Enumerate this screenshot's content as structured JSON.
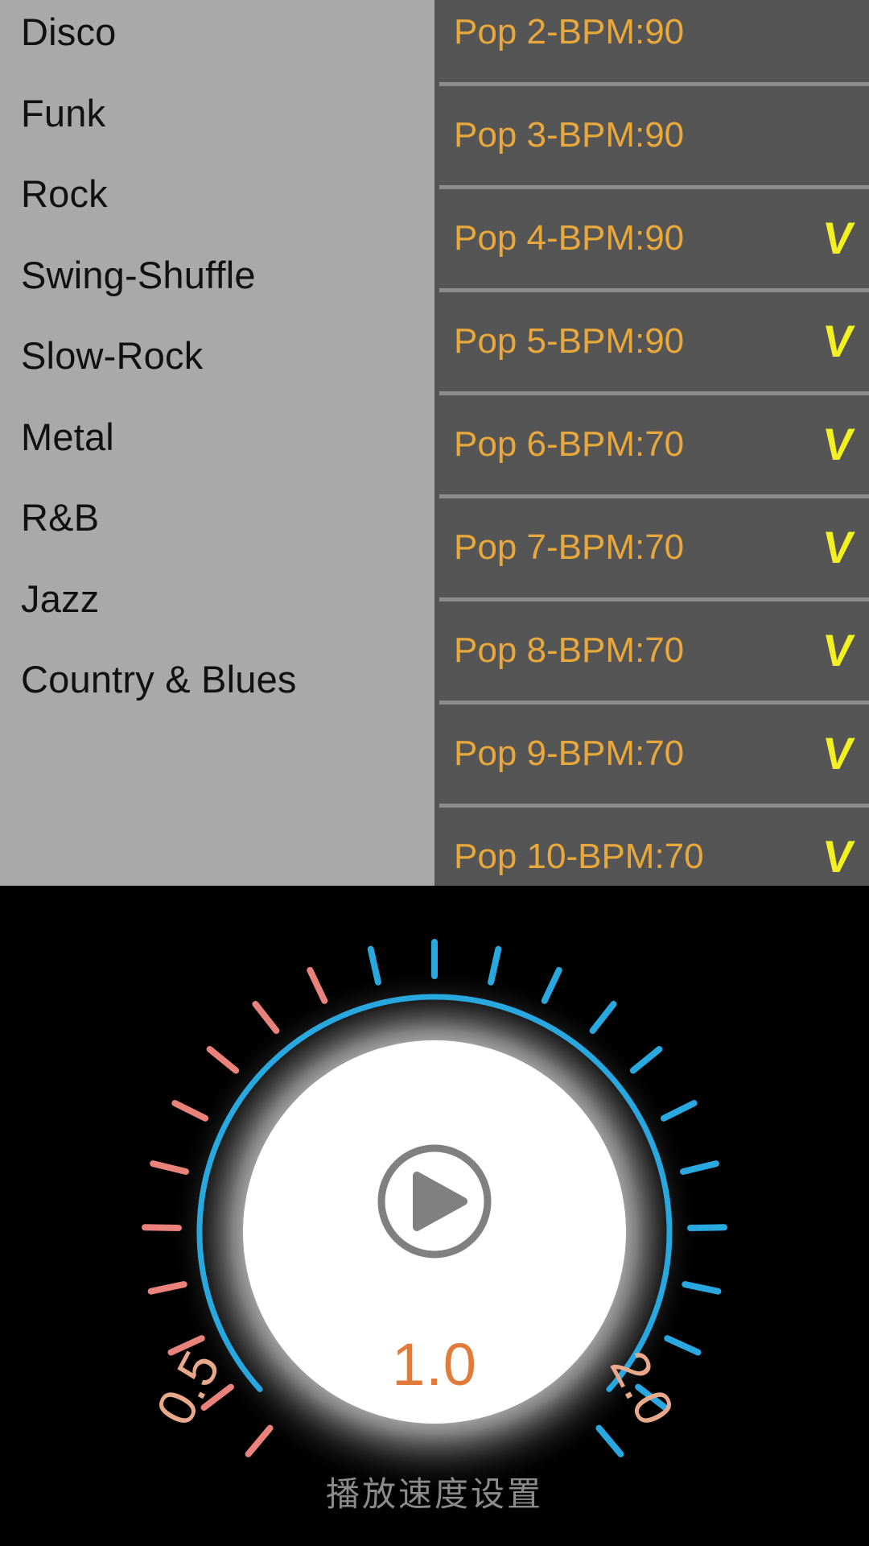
{
  "genre_sidebar": {
    "background_color": "#a9a9a9",
    "items": [
      {
        "label": "Disco"
      },
      {
        "label": "Funk"
      },
      {
        "label": "Rock"
      },
      {
        "label": "Swing-Shuffle"
      },
      {
        "label": "Slow-Rock"
      },
      {
        "label": "Metal"
      },
      {
        "label": "R&B"
      },
      {
        "label": "Jazz"
      },
      {
        "label": "Country & Blues"
      }
    ]
  },
  "pattern_list": {
    "background_color": "#555555",
    "text_color": "#e8a83c",
    "check_color": "#f2ef22",
    "check_glyph": "V",
    "rows": [
      {
        "label": "Pop 2-BPM:90",
        "checked": false
      },
      {
        "label": "Pop 3-BPM:90",
        "checked": false
      },
      {
        "label": "Pop 4-BPM:90",
        "checked": true
      },
      {
        "label": "Pop 5-BPM:90",
        "checked": true
      },
      {
        "label": "Pop 6-BPM:70",
        "checked": true
      },
      {
        "label": "Pop 7-BPM:70",
        "checked": true
      },
      {
        "label": "Pop 8-BPM:70",
        "checked": true
      },
      {
        "label": "Pop 9-BPM:70",
        "checked": true
      },
      {
        "label": "Pop 10-BPM:70",
        "checked": true
      }
    ]
  },
  "speed_knob": {
    "caption": "播放速度设置",
    "value": "1.0",
    "min_label": "0.5",
    "max_label": "2.0",
    "value_color": "#e07b39",
    "arc_color": "#29a8e0",
    "low_tick_color": "#e8827a",
    "high_tick_color": "#29a8e0",
    "label_color": "#e8a88c",
    "caption_color": "#8b8b8b",
    "play_icon": "play-icon",
    "play_color": "#808080"
  }
}
